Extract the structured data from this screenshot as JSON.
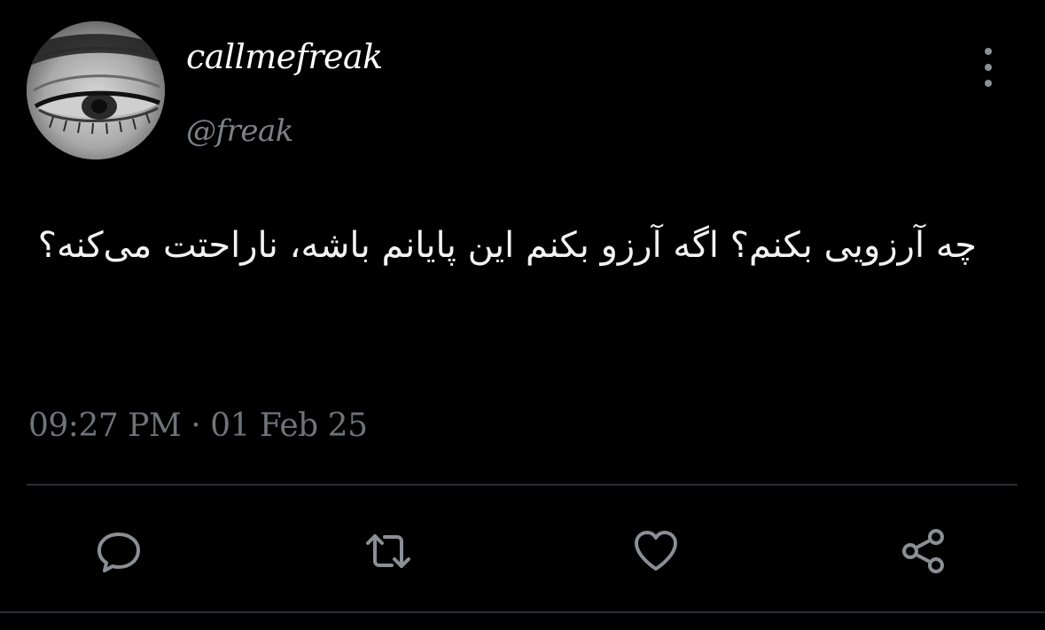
{
  "tweet": {
    "display_name": "callmefreak",
    "handle": "@freak",
    "text": "چه آرزویی بکنم؟ اگه آرزو بکنم این پایانم باشه، ناراحتت می‌کنه؟",
    "timestamp": "09:27 PM · 01 Feb 25"
  },
  "actions": {
    "reply_icon": "speech-bubble-icon",
    "retweet_icon": "retweet-icon",
    "like_icon": "heart-icon",
    "share_icon": "share-icon"
  },
  "colors": {
    "background": "#000000",
    "text": "#f2f2f2",
    "secondary_text": "#7d8288",
    "icon": "#8a8f95",
    "divider": "#2a2d31"
  }
}
